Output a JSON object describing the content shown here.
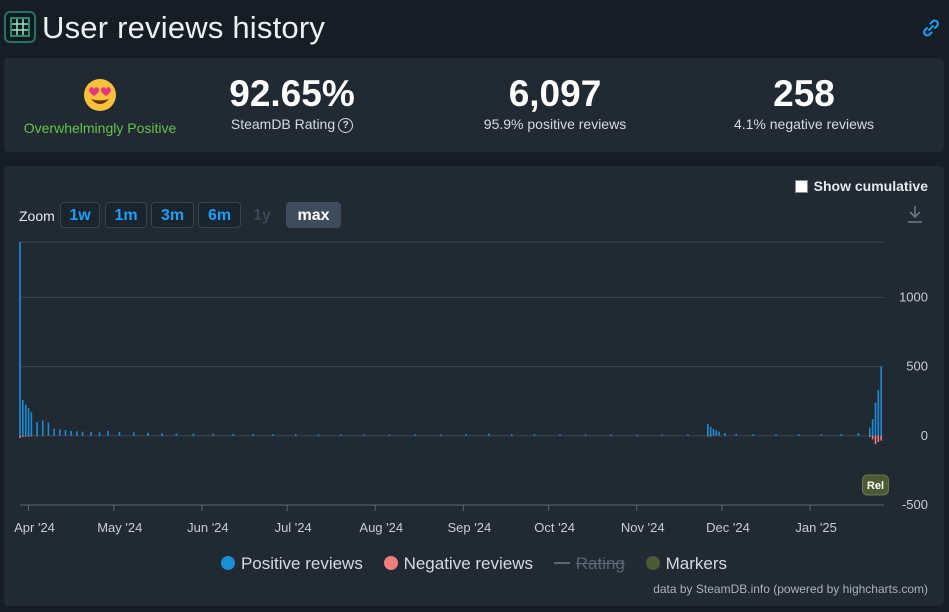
{
  "header": {
    "title": "User reviews history"
  },
  "summary": {
    "rating_word": "Overwhelmingly Positive",
    "steamdb_rating": "92.65%",
    "steamdb_rating_label": "SteamDB Rating",
    "help_glyph": "?",
    "total_reviews": "6,097",
    "positive_label": "95.9% positive reviews",
    "negative_count": "258",
    "negative_label": "4.1% negative reviews"
  },
  "controls": {
    "show_cumulative": "Show cumulative",
    "zoom_label": "Zoom",
    "zoom_options": [
      "1w",
      "1m",
      "3m",
      "6m",
      "1y",
      "max"
    ],
    "active_zoom": "max"
  },
  "legend": {
    "positive": "Positive reviews",
    "negative": "Negative reviews",
    "rating": "Rating",
    "markers": "Markers"
  },
  "credit": "data by SteamDB.info (powered by highcharts.com)",
  "colors": {
    "positive": "#1a8fd8",
    "negative": "#f07d7d",
    "markers": "#4b5a33",
    "rating_good": "#66c24a"
  },
  "icons": {
    "logo": "steamdb-logo-icon",
    "link": "link-icon",
    "rating_emoji": "heart-eyes-emoji-icon",
    "help": "help-circle-icon",
    "download": "download-icon"
  },
  "chart_data": {
    "type": "bar",
    "x_start": "2024-03-29",
    "x_end": "2025-01-27",
    "xticks": [
      {
        "date": "2024-04-01",
        "label": "Apr '24"
      },
      {
        "date": "2024-05-01",
        "label": "May '24"
      },
      {
        "date": "2024-06-01",
        "label": "Jun '24"
      },
      {
        "date": "2024-07-01",
        "label": "Jul '24"
      },
      {
        "date": "2024-08-01",
        "label": "Aug '24"
      },
      {
        "date": "2024-09-01",
        "label": "Sep '24"
      },
      {
        "date": "2024-10-01",
        "label": "Oct '24"
      },
      {
        "date": "2024-11-01",
        "label": "Nov '24"
      },
      {
        "date": "2024-12-01",
        "label": "Dec '24"
      },
      {
        "date": "2025-01-01",
        "label": "Jan '25"
      }
    ],
    "yticks": [
      {
        "value": 1000,
        "label": "1000"
      },
      {
        "value": 500,
        "label": "500"
      },
      {
        "value": 0,
        "label": "0"
      },
      {
        "value": -500,
        "label": "-500"
      }
    ],
    "ylim": [
      -500,
      1400
    ],
    "grid": true,
    "series": [
      {
        "name": "Positive reviews",
        "points": [
          [
            "2024-03-29",
            1400
          ],
          [
            "2024-03-30",
            260
          ],
          [
            "2024-03-31",
            225
          ],
          [
            "2024-04-01",
            200
          ],
          [
            "2024-04-02",
            170
          ],
          [
            "2024-04-04",
            100
          ],
          [
            "2024-04-06",
            110
          ],
          [
            "2024-04-08",
            95
          ],
          [
            "2024-04-10",
            50
          ],
          [
            "2024-04-12",
            45
          ],
          [
            "2024-04-14",
            40
          ],
          [
            "2024-04-16",
            35
          ],
          [
            "2024-04-18",
            32
          ],
          [
            "2024-04-20",
            30
          ],
          [
            "2024-04-23",
            28
          ],
          [
            "2024-04-26",
            25
          ],
          [
            "2024-04-29",
            35
          ],
          [
            "2024-05-03",
            28
          ],
          [
            "2024-05-08",
            25
          ],
          [
            "2024-05-13",
            22
          ],
          [
            "2024-05-18",
            18
          ],
          [
            "2024-05-23",
            16
          ],
          [
            "2024-05-29",
            15
          ],
          [
            "2024-06-05",
            14
          ],
          [
            "2024-06-12",
            13
          ],
          [
            "2024-06-19",
            12
          ],
          [
            "2024-06-26",
            11
          ],
          [
            "2024-07-04",
            12
          ],
          [
            "2024-07-12",
            10
          ],
          [
            "2024-07-20",
            10
          ],
          [
            "2024-07-28",
            9
          ],
          [
            "2024-08-06",
            9
          ],
          [
            "2024-08-15",
            10
          ],
          [
            "2024-08-24",
            9
          ],
          [
            "2024-09-02",
            12
          ],
          [
            "2024-09-10",
            14
          ],
          [
            "2024-09-18",
            12
          ],
          [
            "2024-09-26",
            11
          ],
          [
            "2024-10-05",
            10
          ],
          [
            "2024-10-14",
            9
          ],
          [
            "2024-10-23",
            9
          ],
          [
            "2024-11-01",
            8
          ],
          [
            "2024-11-10",
            9
          ],
          [
            "2024-11-19",
            10
          ],
          [
            "2024-11-26",
            85
          ],
          [
            "2024-11-27",
            65
          ],
          [
            "2024-11-28",
            50
          ],
          [
            "2024-11-29",
            40
          ],
          [
            "2024-11-30",
            30
          ],
          [
            "2024-12-02",
            20
          ],
          [
            "2024-12-06",
            15
          ],
          [
            "2024-12-12",
            12
          ],
          [
            "2024-12-20",
            10
          ],
          [
            "2024-12-28",
            12
          ],
          [
            "2025-01-05",
            11
          ],
          [
            "2025-01-12",
            13
          ],
          [
            "2025-01-18",
            20
          ],
          [
            "2025-01-22",
            60
          ],
          [
            "2025-01-23",
            120
          ],
          [
            "2025-01-24",
            240
          ],
          [
            "2025-01-25",
            330
          ],
          [
            "2025-01-26",
            500
          ]
        ]
      },
      {
        "name": "Negative reviews",
        "points": [
          [
            "2024-03-29",
            -15
          ],
          [
            "2024-03-30",
            -8
          ],
          [
            "2024-03-31",
            -6
          ],
          [
            "2024-04-01",
            -5
          ],
          [
            "2024-04-02",
            -4
          ],
          [
            "2024-04-04",
            -3
          ],
          [
            "2024-11-26",
            -4
          ],
          [
            "2024-11-27",
            -3
          ],
          [
            "2025-01-22",
            -8
          ],
          [
            "2025-01-23",
            -25
          ],
          [
            "2025-01-24",
            -60
          ],
          [
            "2025-01-25",
            -45
          ],
          [
            "2025-01-26",
            -35
          ]
        ]
      }
    ],
    "markers": [
      {
        "date": "2025-01-24",
        "label": "Rel"
      }
    ]
  }
}
